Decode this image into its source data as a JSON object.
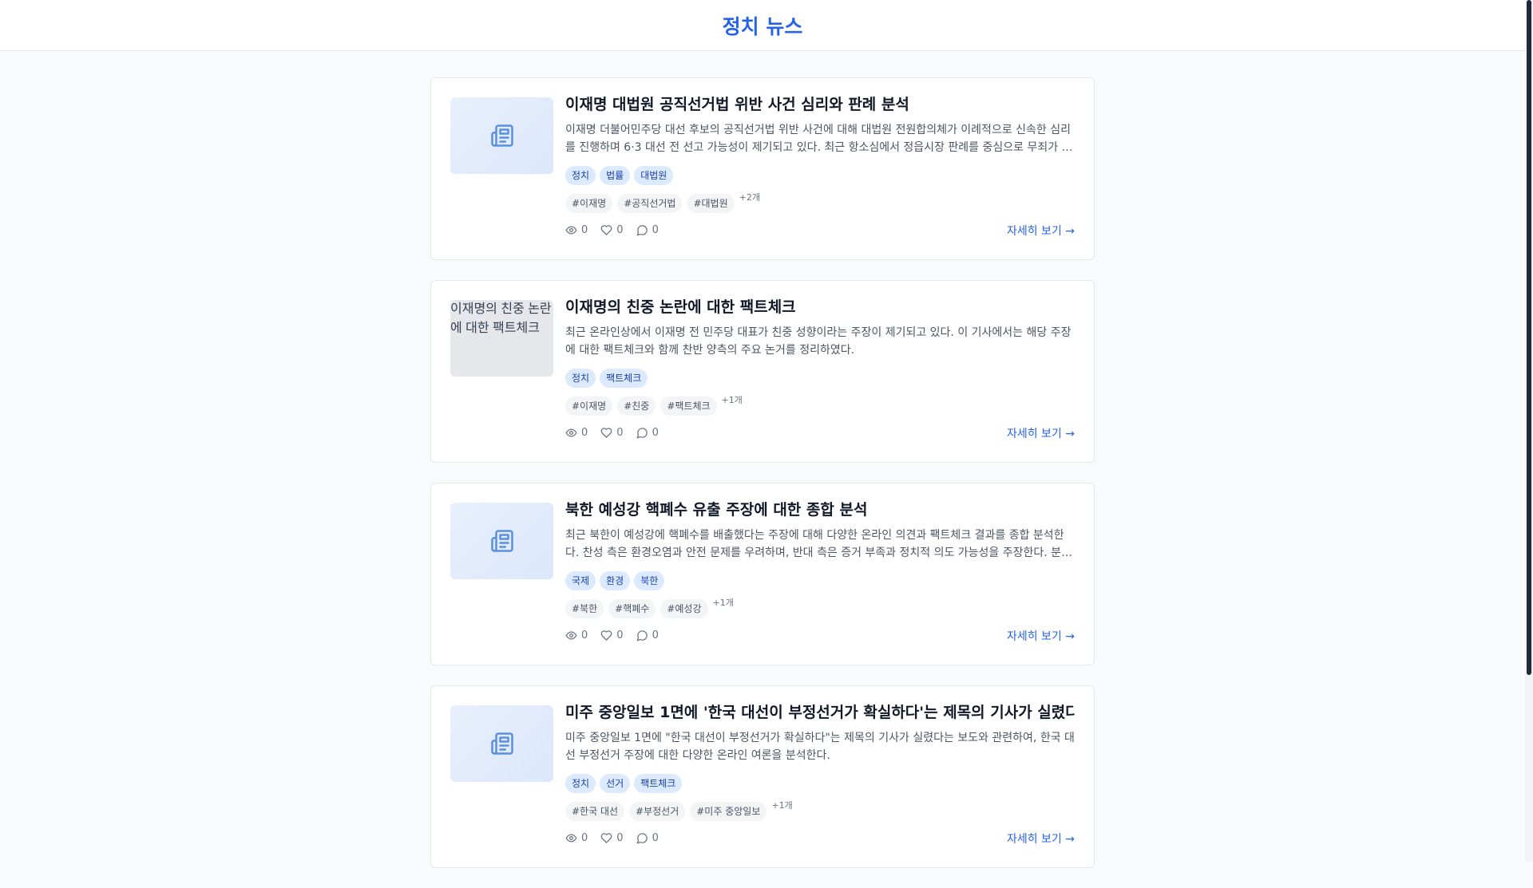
{
  "header": {
    "title": "정치 뉴스"
  },
  "articles": [
    {
      "title": "이재명 대법원 공직선거법 위반 사건 심리와 판례 분석",
      "summary": "이재명 더불어민주당 대선 후보의 공직선거법 위반 사건에 대해 대법원 전원합의체가 이례적으로 신속한 심리를 진행하며 6·3 대선 전 선고 가능성이 제기되고 있다. 최근 항소심에서 정읍시장 판례를 중심으로 무죄가 선고된 바 있다.",
      "categories": [
        "정치",
        "법률",
        "대법원"
      ],
      "tags": [
        "#이재명",
        "#공직선거법",
        "#대법원"
      ],
      "more_tags": "+2개",
      "views": "0",
      "likes": "0",
      "comments": "0",
      "link": "자세히 보기 →"
    },
    {
      "thumb_alt": "이재명의 친중 논란에 대한 팩트체크",
      "title": "이재명의 친중 논란에 대한 팩트체크",
      "summary": "최근 온라인상에서 이재명 전 민주당 대표가 친중 성향이라는 주장이 제기되고 있다. 이 기사에서는 해당 주장에 대한 팩트체크와 함께 찬반 양측의 주요 논거를 정리하였다.",
      "categories": [
        "정치",
        "팩트체크"
      ],
      "tags": [
        "#이재명",
        "#친중",
        "#팩트체크"
      ],
      "more_tags": "+1개",
      "views": "0",
      "likes": "0",
      "comments": "0",
      "link": "자세히 보기 →"
    },
    {
      "title": "북한 예성강 핵폐수 유출 주장에 대한 종합 분석",
      "summary": "최근 북한이 예성강에 핵폐수를 배출했다는 주장에 대해 다양한 온라인 의견과 팩트체크 결과를 종합 분석한다. 찬성 측은 환경오염과 안전 문제를 우려하며, 반대 측은 증거 부족과 정치적 의도 가능성을 주장한다. 분석 결과를 정리한다.",
      "categories": [
        "국제",
        "환경",
        "북한"
      ],
      "tags": [
        "#북한",
        "#핵폐수",
        "#예성강"
      ],
      "more_tags": "+1개",
      "views": "0",
      "likes": "0",
      "comments": "0",
      "link": "자세히 보기 →"
    },
    {
      "title": "미주 중앙일보 1면에 '한국 대선이 부정선거가 확실하다'는 제목의 기사가 실렸다",
      "summary": "미주 중앙일보 1면에 \"한국 대선이 부정선거가 확실하다\"는 제목의 기사가 실렸다는 보도와 관련하여, 한국 대선 부정선거 주장에 대한 다양한 온라인 여론을 분석한다.",
      "categories": [
        "정치",
        "선거",
        "팩트체크"
      ],
      "tags": [
        "#한국 대선",
        "#부정선거",
        "#미주 중앙일보"
      ],
      "more_tags": "+1개",
      "views": "0",
      "likes": "0",
      "comments": "0",
      "link": "자세히 보기 →"
    }
  ],
  "icons": {
    "thumb_placeholder": "newspaper-icon",
    "views": "eye-icon",
    "likes": "heart-icon",
    "comments": "comment-icon"
  },
  "colors": {
    "accent": "#2563eb",
    "category_bg": "#dbeafe",
    "category_text": "#1e40af",
    "tag_bg": "#f3f4f6"
  }
}
